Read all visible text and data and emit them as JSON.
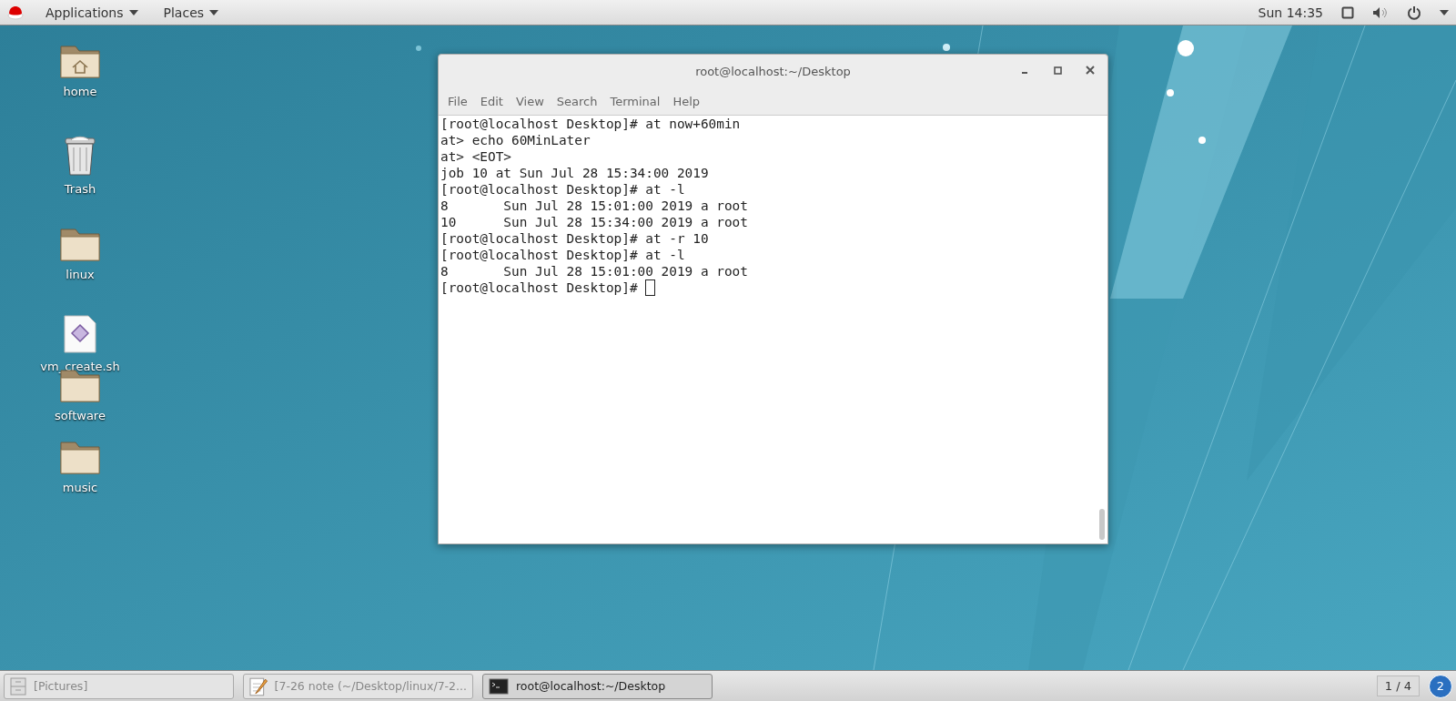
{
  "top_bar": {
    "menus": [
      {
        "label": "Applications"
      },
      {
        "label": "Places"
      }
    ],
    "clock": "Sun 14:35"
  },
  "desktop_icons": [
    {
      "label": "home",
      "kind": "home-folder"
    },
    {
      "label": "Trash",
      "kind": "trash"
    },
    {
      "label": "linux",
      "kind": "folder"
    },
    {
      "label": "vm_create.sh",
      "kind": "script"
    },
    {
      "label": "software",
      "kind": "folder"
    },
    {
      "label": "music",
      "kind": "folder"
    }
  ],
  "window": {
    "title": "root@localhost:~/Desktop",
    "menu": [
      "File",
      "Edit",
      "View",
      "Search",
      "Terminal",
      "Help"
    ],
    "lines": [
      "[root@localhost Desktop]# at now+60min",
      "at> echo 60MinLater",
      "at> <EOT>",
      "job 10 at Sun Jul 28 15:34:00 2019",
      "[root@localhost Desktop]# at -l",
      "8       Sun Jul 28 15:01:00 2019 a root",
      "10      Sun Jul 28 15:34:00 2019 a root",
      "[root@localhost Desktop]# at -r 10",
      "[root@localhost Desktop]# at -l",
      "8       Sun Jul 28 15:01:00 2019 a root",
      "[root@localhost Desktop]# "
    ]
  },
  "taskbar": {
    "items": [
      {
        "label": "[Pictures]",
        "kind": "files",
        "selected": false
      },
      {
        "label": "[7-26 note (~/Desktop/linux/7-2...",
        "kind": "editor",
        "selected": false
      },
      {
        "label": "root@localhost:~/Desktop",
        "kind": "terminal",
        "selected": true
      }
    ],
    "workspace": "1 / 4",
    "notifications": "2"
  }
}
